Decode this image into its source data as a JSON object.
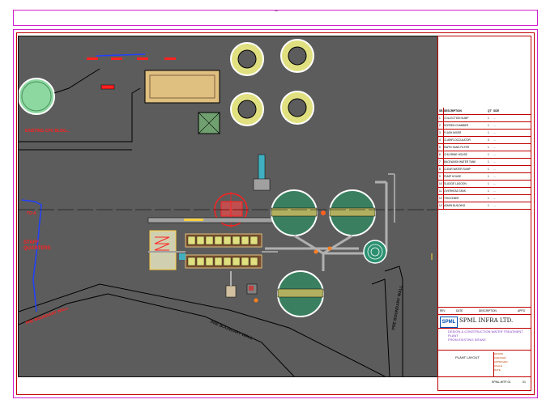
{
  "sheet": {
    "labels": {
      "existing_cpu": "EXISTING CPU BLDG...",
      "to_a": "TO A",
      "staff_quarters": "STAFF\nQUARTERS",
      "pre_boundary_wall": "PRE BOUNDARY WALL",
      "road_bottom": "PRE BOUNDARY WALL",
      "road_right": "PRE BOUNDARY WALL"
    }
  },
  "title_block": {
    "header": {
      "no": "SR.",
      "description": "DESCRIPTION",
      "qty": "QTY",
      "size": "SIZE"
    },
    "rows": [
      {
        "no": "1",
        "description": "COLLECTION SUMP",
        "qty": "1",
        "size": "..."
      },
      {
        "no": "2",
        "description": "SCREEN CHAMBER",
        "qty": "1",
        "size": "..."
      },
      {
        "no": "3",
        "description": "FLASH MIXER",
        "qty": "1",
        "size": "..."
      },
      {
        "no": "4",
        "description": "CLARIFLOCCULATOR",
        "qty": "2",
        "size": "..."
      },
      {
        "no": "5",
        "description": "RAPID SAND FILTER",
        "qty": "1",
        "size": "..."
      },
      {
        "no": "6",
        "description": "CHLORINE HOUSE",
        "qty": "1",
        "size": "..."
      },
      {
        "no": "7",
        "description": "BACKWASH WATER TANK",
        "qty": "1",
        "size": "..."
      },
      {
        "no": "8",
        "description": "CLEAR WATER SUMP",
        "qty": "1",
        "size": "..."
      },
      {
        "no": "9",
        "description": "PUMP HOUSE",
        "qty": "1",
        "size": "..."
      },
      {
        "no": "10",
        "description": "SLUDGE LAGOON",
        "qty": "1",
        "size": "..."
      },
      {
        "no": "11",
        "description": "OVERHEAD TANK",
        "qty": "1",
        "size": "..."
      },
      {
        "no": "12",
        "description": "THICKENER",
        "qty": "1",
        "size": "..."
      },
      {
        "no": "13",
        "description": "ADMIN BUILDING",
        "qty": "1",
        "size": "..."
      }
    ],
    "revision": {
      "rev": "REV",
      "date": "DATE",
      "description": "DESCRIPTION",
      "appd": "APP'D"
    },
    "logo_text": "SPML",
    "company": "SPML INFRA LTD.",
    "project_lines": [
      "DESIGN & CONSTRUCTION WATER TREATMENT",
      "PLANT",
      "FROM EXISTING INTAKE"
    ],
    "drawing_title": "PLANT LAYOUT",
    "side_fields": [
      "DRAWN",
      "CHECKED",
      "APPROVED",
      "SCALE",
      "DATE"
    ],
    "drawing_no": "SPML-WTP-01",
    "sheet_no": "01"
  },
  "colors": {
    "frame": "#d020d0",
    "border": "#c00000",
    "drawing_bg": "#5c5c5c",
    "tank_fill": "#e0e080",
    "clarifier_fill": "#3a8060"
  }
}
